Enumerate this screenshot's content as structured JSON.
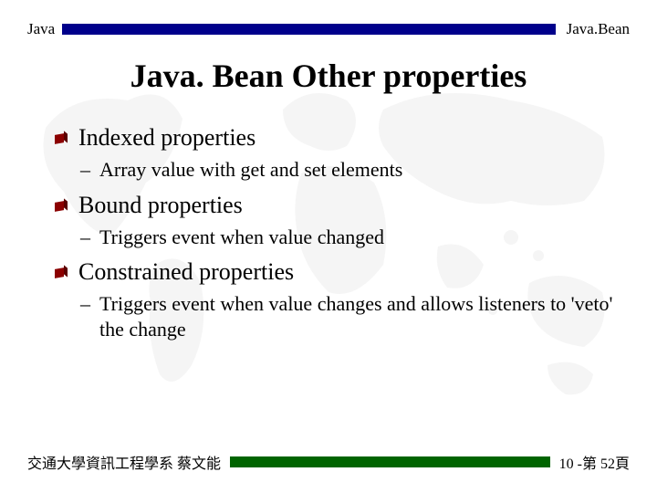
{
  "header": {
    "left": "Java",
    "right": "Java.Bean"
  },
  "title": "Java. Bean Other properties",
  "bullets": [
    {
      "text": "Indexed properties",
      "subs": [
        "Array value with get and set elements"
      ]
    },
    {
      "text": "Bound properties",
      "subs": [
        "Triggers event when value changed"
      ]
    },
    {
      "text": "Constrained properties",
      "subs": [
        "Triggers event when value changes and allows listeners to 'veto' the change"
      ]
    }
  ],
  "footer": {
    "left": "交通大學資訊工程學系 蔡文能",
    "right": "10 -第 52頁"
  }
}
